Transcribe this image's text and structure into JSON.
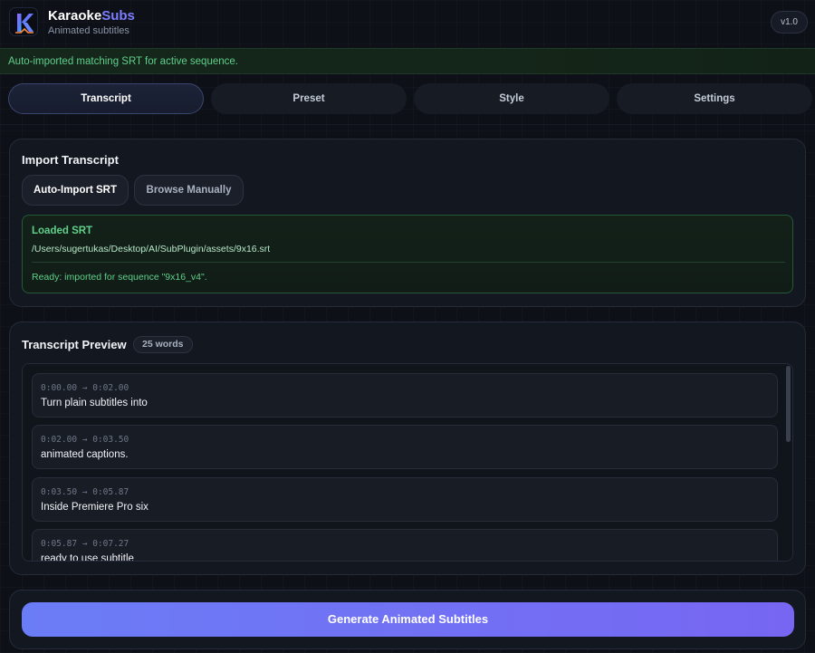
{
  "app": {
    "name_main": "Karaoke",
    "name_accent": "Subs",
    "subtitle": "Animated subtitles",
    "version": "v1.0"
  },
  "banner": {
    "message": "Auto-imported matching SRT for active sequence."
  },
  "tabs": [
    {
      "label": "Transcript",
      "active": true
    },
    {
      "label": "Preset",
      "active": false
    },
    {
      "label": "Style",
      "active": false
    },
    {
      "label": "Settings",
      "active": false
    }
  ],
  "import_section": {
    "title": "Import Transcript",
    "auto_import_label": "Auto-Import SRT",
    "browse_label": "Browse Manually",
    "loaded": {
      "title": "Loaded SRT",
      "path": "/Users/sugertukas/Desktop/AI/SubPlugin/assets/9x16.srt",
      "status": "Ready: imported for sequence \"9x16_v4\"."
    }
  },
  "preview_section": {
    "title": "Transcript Preview",
    "word_count": "25 words",
    "items": [
      {
        "time": "0:00.00 → 0:02.00",
        "text": "Turn plain subtitles into"
      },
      {
        "time": "0:02.00 → 0:03.50",
        "text": "animated captions."
      },
      {
        "time": "0:03.50 → 0:05.87",
        "text": "Inside Premiere Pro six"
      },
      {
        "time": "0:05.87 → 0:07.27",
        "text": "ready to use subtitle"
      }
    ]
  },
  "generate": {
    "label": "Generate Animated Subtitles"
  },
  "colors": {
    "accent": "#7d7dff",
    "success": "#5fd08a",
    "background": "#0d1117",
    "button_gradient_start": "#6b7df6",
    "button_gradient_end": "#7766f2"
  }
}
